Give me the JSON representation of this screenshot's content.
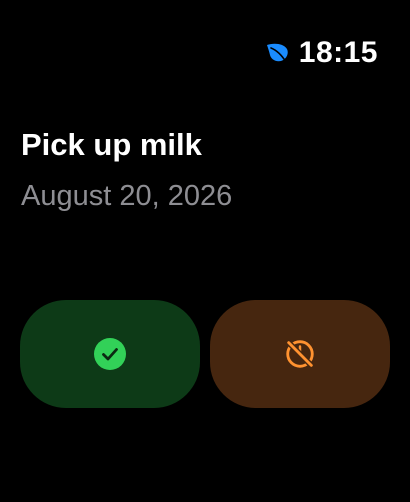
{
  "status_bar": {
    "app_icon": "leaf-icon",
    "time": "18:15",
    "accent_color": "#1a8cff"
  },
  "reminder": {
    "title": "Pick up milk",
    "date": "August 20, 2026"
  },
  "actions": {
    "complete": {
      "icon": "checkmark-circle-icon",
      "color": "#32d158",
      "background": "#0d3a17"
    },
    "dismiss": {
      "icon": "dismiss-slash-circle-icon",
      "color": "#ff9230",
      "background": "#46260f"
    }
  }
}
